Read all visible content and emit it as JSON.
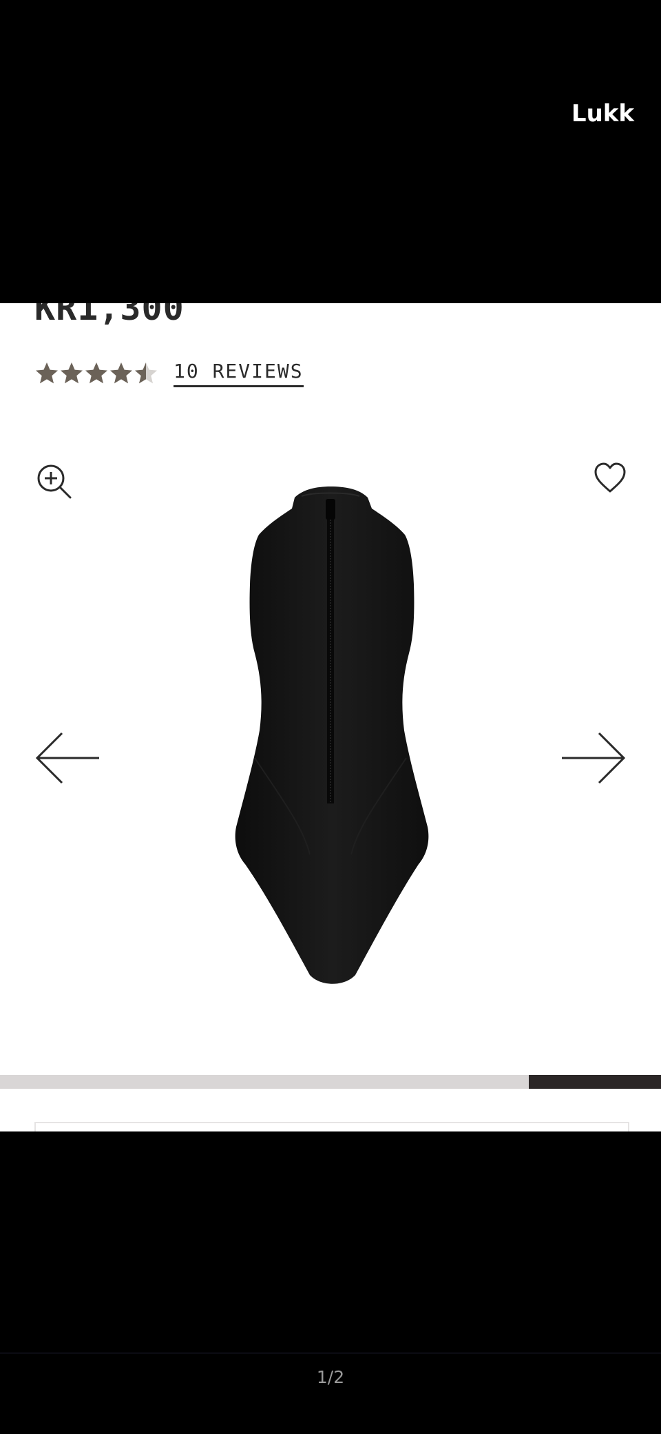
{
  "viewer": {
    "close_label": "Lukk",
    "counter": "1/2"
  },
  "product": {
    "price": "KR1,300",
    "rating": 4.5,
    "rating_max": 5,
    "reviews_label": "10 REVIEWS",
    "image_description_icon": "swimsuit-image"
  },
  "carousel": {
    "progress_fraction": 0.2,
    "progress_position": "end"
  },
  "colors": {
    "star_fill": "#6b6258",
    "star_empty": "#d6d3d0",
    "text": "#2a2a2a",
    "progress_track": "#d9d6d6",
    "progress_fill": "#2b2626"
  },
  "icons": {
    "zoom": "zoom-in-icon",
    "wishlist": "heart-icon",
    "prev": "arrow-left-icon",
    "next": "arrow-right-icon",
    "star": "star-icon"
  }
}
